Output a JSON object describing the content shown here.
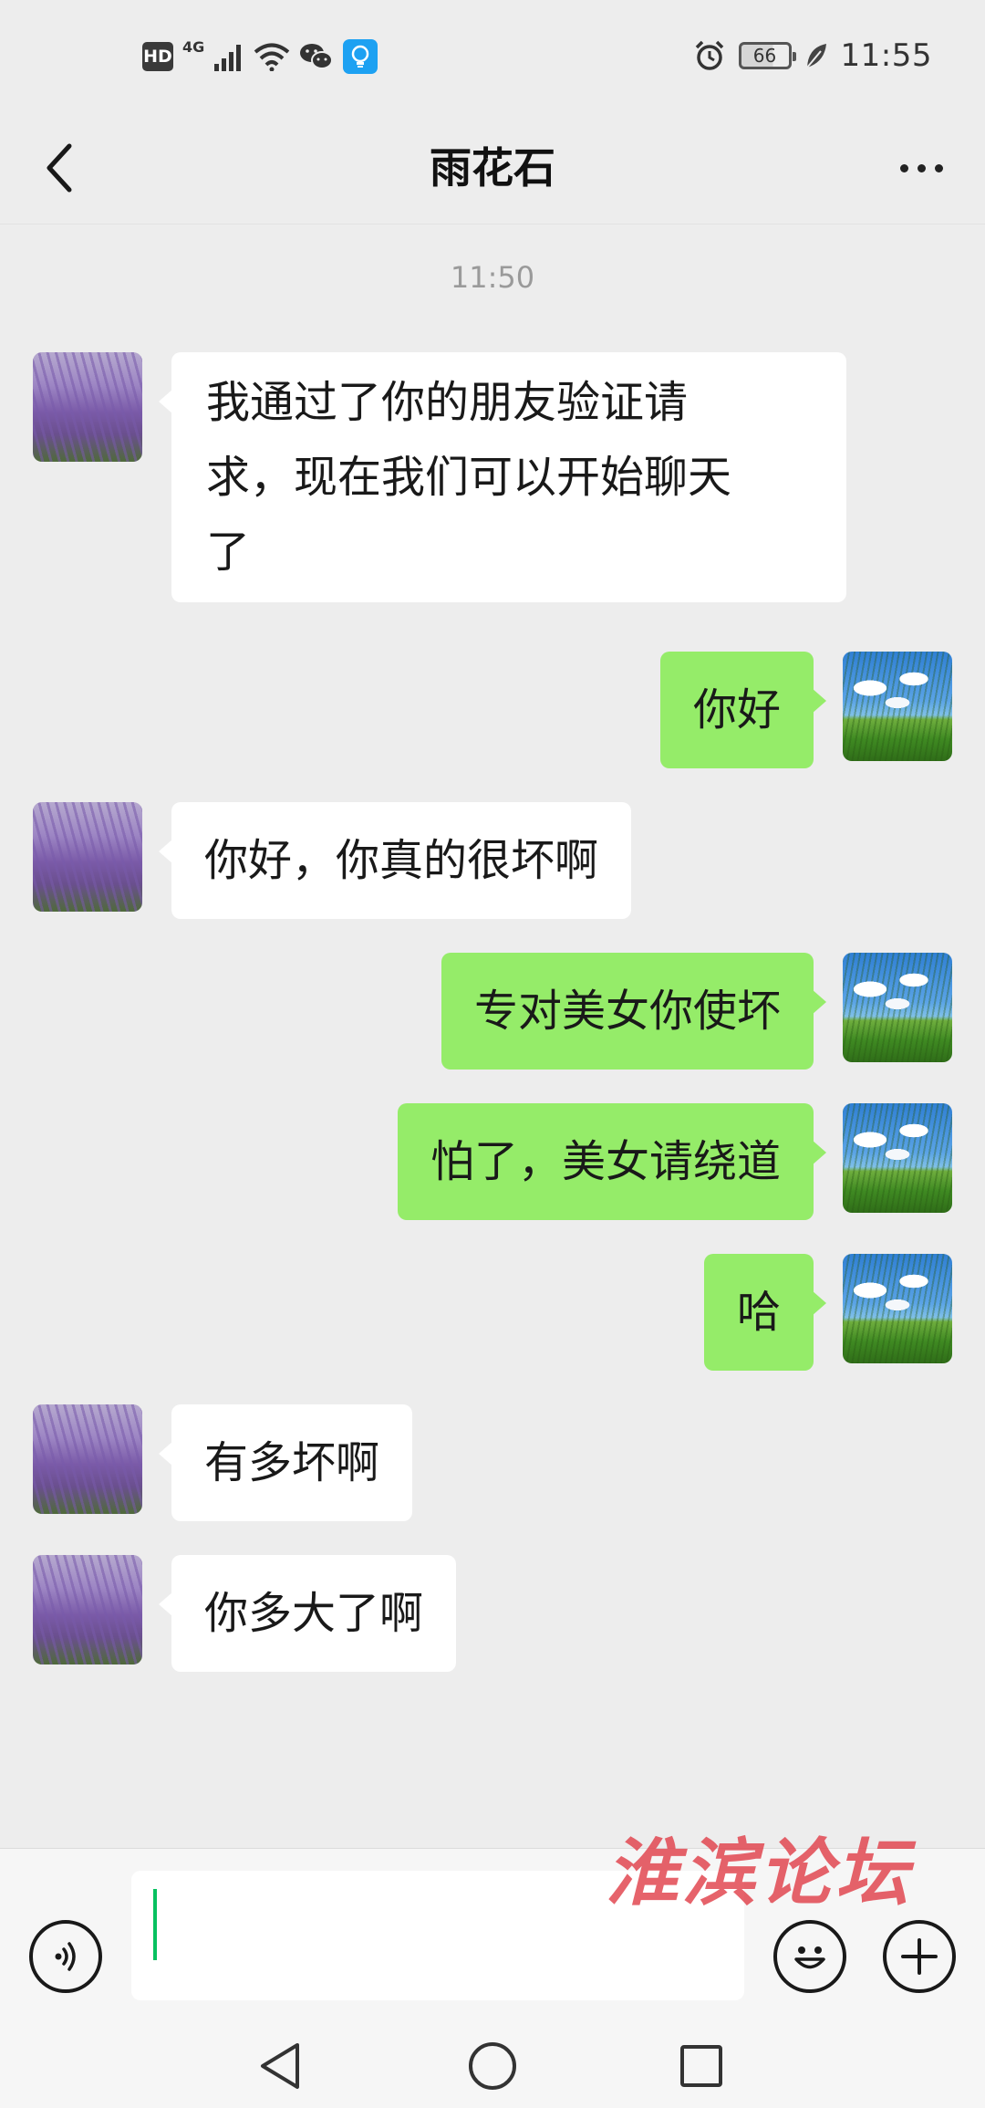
{
  "status_bar": {
    "hd_label": "HD",
    "network_label": "4G",
    "battery_level": "66",
    "time": "11:55",
    "icons": [
      "hd-icon",
      "signal-icon",
      "wifi-icon",
      "wechat-icon",
      "lightbulb-icon",
      "alarm-icon",
      "battery-icon",
      "leaf-icon"
    ]
  },
  "header": {
    "title": "雨花石",
    "back_icon": "chevron-left-icon",
    "more_icon": "more-dots-icon"
  },
  "chat": {
    "timestamp": "11:50",
    "messages": [
      {
        "side": "left",
        "text": "我通过了你的朋友验证请\n求，现在我们可以开始聊天\n了"
      },
      {
        "side": "right",
        "text": "你好"
      },
      {
        "side": "left",
        "text": "你好，你真的很坏啊"
      },
      {
        "side": "right",
        "text": "专对美女你使坏"
      },
      {
        "side": "right",
        "text": "怕了，美女请绕道"
      },
      {
        "side": "right",
        "text": "哈"
      },
      {
        "side": "left",
        "text": "有多坏啊"
      },
      {
        "side": "left",
        "text": "你多大了啊"
      }
    ]
  },
  "input_bar": {
    "value": "",
    "icons": [
      "voice-icon",
      "emoji-icon",
      "plus-icon"
    ]
  },
  "watermark": "淮滨论坛",
  "nav_bar": {
    "icons": [
      "back-triangle-icon",
      "home-circle-icon",
      "recents-square-icon"
    ]
  },
  "colors": {
    "background": "#ededed",
    "my_bubble": "#95ec69",
    "their_bubble": "#ffffff",
    "caret": "#07c160",
    "watermark": "#e03c46"
  }
}
